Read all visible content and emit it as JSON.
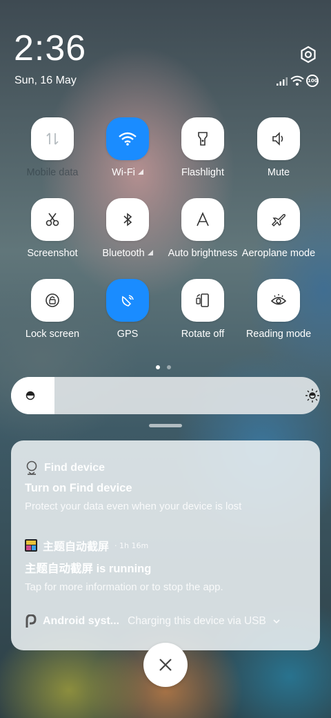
{
  "status_bar": {
    "time": "2:36",
    "date": "Sun, 16 May",
    "battery_text": "100"
  },
  "quick_settings": {
    "tiles": [
      {
        "label": "Mobile data",
        "icon": "mobile-data-icon",
        "active": false,
        "disabled": true
      },
      {
        "label": "Wi-Fi",
        "icon": "wifi-icon",
        "active": true,
        "has_more": true
      },
      {
        "label": "Flashlight",
        "icon": "flashlight-icon",
        "active": false
      },
      {
        "label": "Mute",
        "icon": "speaker-icon",
        "active": false
      },
      {
        "label": "Screenshot",
        "icon": "scissors-icon",
        "active": false
      },
      {
        "label": "Bluetooth",
        "icon": "bluetooth-icon",
        "active": false,
        "has_more": true
      },
      {
        "label": "Auto brightness",
        "icon": "auto-brightness-icon",
        "active": false
      },
      {
        "label": "Aeroplane mode",
        "icon": "aeroplane-icon",
        "active": false
      },
      {
        "label": "Lock screen",
        "icon": "lock-screen-icon",
        "active": false
      },
      {
        "label": "GPS",
        "icon": "gps-icon",
        "active": true
      },
      {
        "label": "Rotate off",
        "icon": "rotate-icon",
        "active": false
      },
      {
        "label": "Reading mode",
        "icon": "eye-icon",
        "active": false
      }
    ],
    "page_count": 2,
    "current_page": 1
  },
  "brightness": {
    "level": 0.14
  },
  "notifications": [
    {
      "app": "Find device",
      "time": "",
      "title": "Turn on Find device",
      "body": "Protect your data even when your device is lost"
    },
    {
      "app": "主题自动截屏",
      "time": "· 1h 16m",
      "title": "主题自动截屏 is running",
      "body": "Tap for more information or to stop the app."
    },
    {
      "app": "Android syst...",
      "message": "Charging this device via USB"
    }
  ],
  "colors": {
    "accent": "#1a8cff",
    "tile_bg": "#ffffff"
  }
}
